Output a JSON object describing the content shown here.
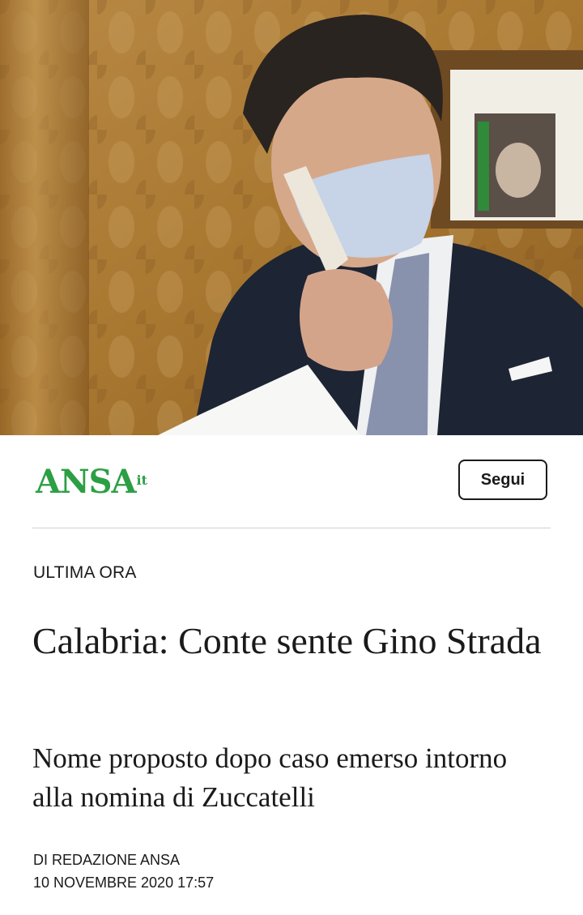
{
  "hero": {
    "image": "photo-man-in-face-mask-on-phone"
  },
  "brand": {
    "logo_main": "ANSA",
    "logo_suffix": "it",
    "logo_color": "#2c9f44",
    "follow_label": "Segui"
  },
  "article": {
    "kicker": "ULTIMA ORA",
    "headline": "Calabria: Conte sente Gino Strada",
    "subheadline": "Nome proposto dopo caso emerso intorno alla nomina di Zuccatelli",
    "author": "DI REDAZIONE ANSA",
    "timestamp": "10 NOVEMBRE 2020 17:57"
  }
}
